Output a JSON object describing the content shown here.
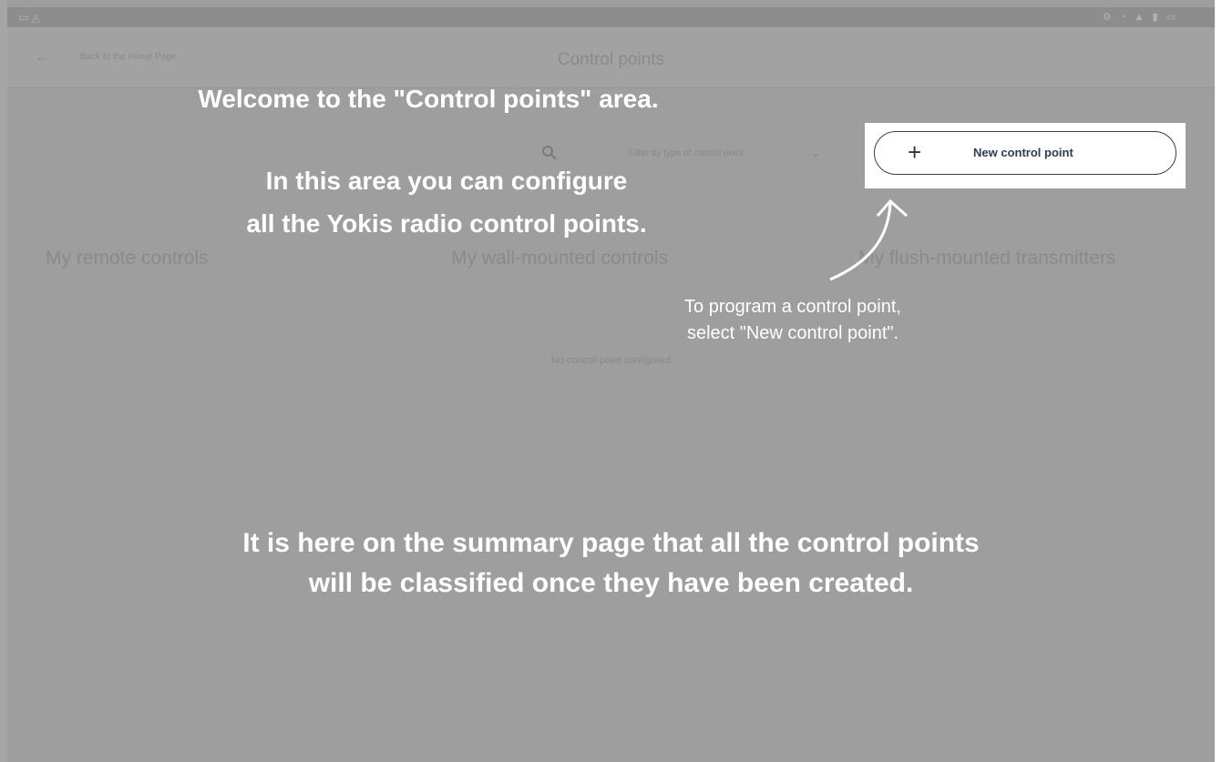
{
  "status_bar": {
    "left_icons": "▭ ◬",
    "right_icons": "⚙ ◔ ▲ ▮ ▭"
  },
  "app_bar": {
    "back_label": "Back to the Home Page",
    "title": "Control points"
  },
  "toolbar": {
    "search_icon": "search-icon",
    "filter_placeholder": "Filter by type of control point",
    "new_button_label": "New control point"
  },
  "categories": [
    "My remote controls",
    "My wall-mounted controls",
    "My flush-mounted transmitters"
  ],
  "empty_message": "No control point configured",
  "overlay": {
    "welcome": "Welcome to the \"Control points\" area.",
    "config_line1": "In this area you can configure",
    "config_line2": "all the Yokis radio control points.",
    "tip_line1": "To program a control point,",
    "tip_line2": "select \"New control point\".",
    "summary_line1": "It is here on the summary page that all the control points",
    "summary_line2": "will be classified once they have been created."
  },
  "colors": {
    "dim_overlay": "#9e9e9e",
    "button_text": "#2e3a59",
    "overlay_text": "#ffffff"
  }
}
